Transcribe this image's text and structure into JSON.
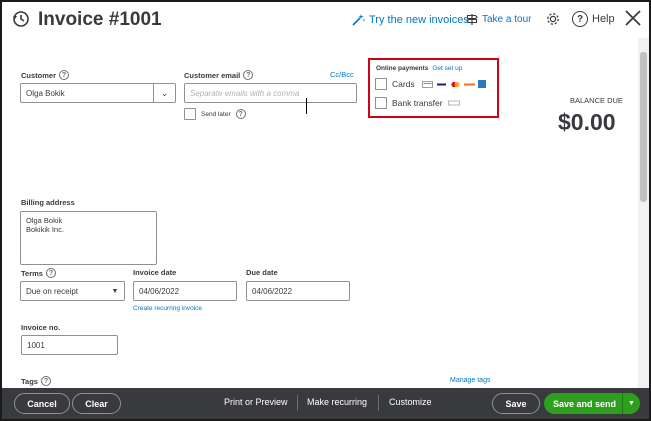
{
  "header": {
    "title": "Invoice #1001",
    "try_new": "Try the new invoices",
    "take_tour": "Take a tour",
    "help": "Help"
  },
  "customer": {
    "label": "Customer",
    "value": "Olga Bokik"
  },
  "email": {
    "label": "Customer email",
    "placeholder": "Separate emails with a comma",
    "cc_bcc": "Cc/Bcc",
    "send_later": "Send later"
  },
  "online_payments": {
    "title": "Online payments",
    "get_set_up": "Get set up",
    "cards": "Cards",
    "bank_transfer": "Bank transfer"
  },
  "balance": {
    "label": "BALANCE DUE",
    "amount": "$0.00"
  },
  "billing": {
    "label": "Billing address",
    "line1": "Olga Bokik",
    "line2": "Bokikik Inc."
  },
  "terms": {
    "label": "Terms",
    "value": "Due on receipt"
  },
  "invoice_date": {
    "label": "Invoice date",
    "value": "04/06/2022",
    "recurring_link": "Create recurring invoice"
  },
  "due_date": {
    "label": "Due date",
    "value": "04/06/2022"
  },
  "invoice_no": {
    "label": "Invoice no.",
    "value": "1001"
  },
  "tags": {
    "label": "Tags",
    "manage": "Manage tags"
  },
  "footer": {
    "cancel": "Cancel",
    "clear": "Clear",
    "print_preview": "Print or Preview",
    "make_recurring": "Make recurring",
    "customize": "Customize",
    "save": "Save",
    "save_and_send": "Save and send"
  },
  "colors": {
    "accent_blue": "#0077c5",
    "green": "#2ca01c",
    "highlight_red": "#d0021b",
    "footer_bg": "#393a3d"
  }
}
